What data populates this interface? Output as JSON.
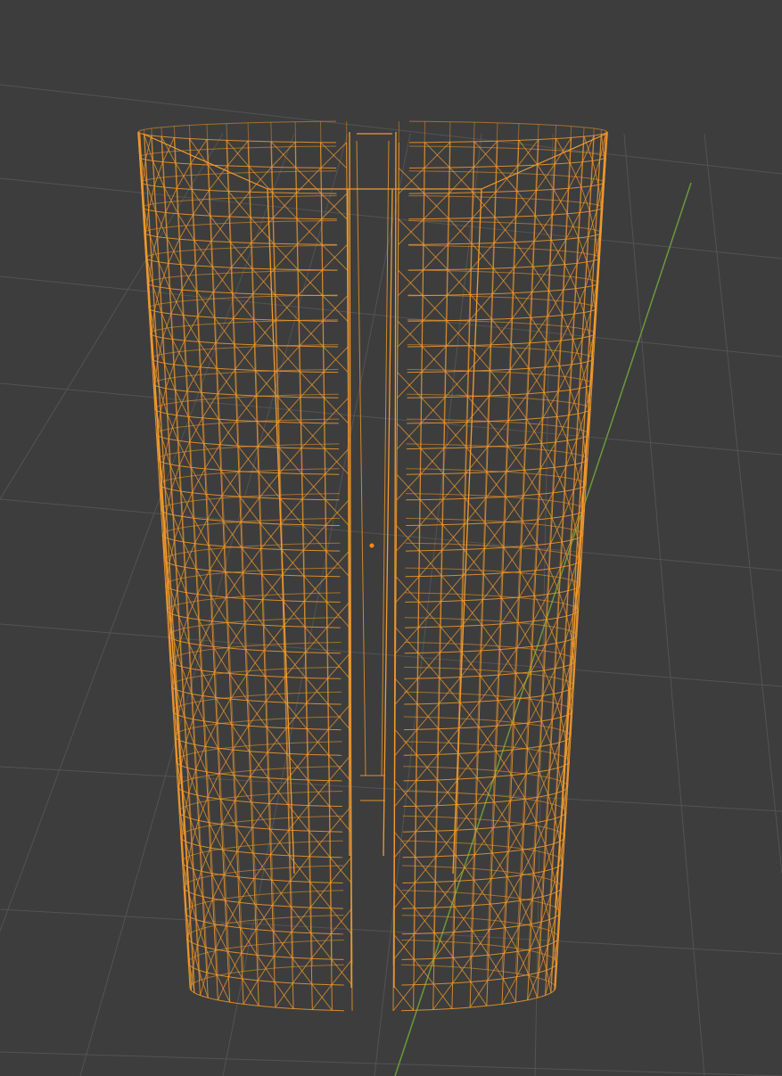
{
  "viewport": {
    "background_color": "#3d3d3d",
    "grid_color": "#555555",
    "y_axis_color": "#6a9a3a",
    "selection_color": "#f39a2c",
    "origin_color": "#ff8a00"
  },
  "object": {
    "shape": "slotted-cylinder",
    "display": "wireframe",
    "selected": true,
    "origin_icon": "origin-dot-icon"
  }
}
